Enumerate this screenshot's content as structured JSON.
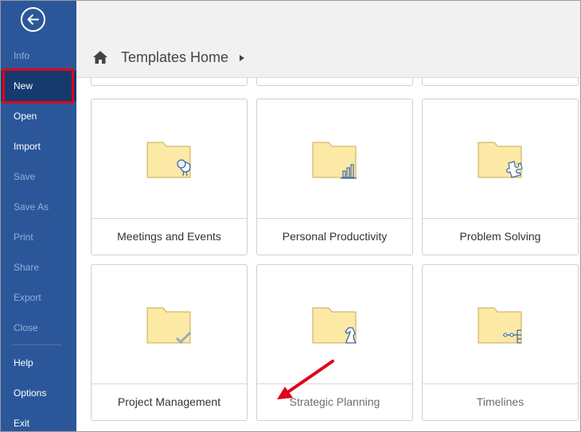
{
  "sidebar": {
    "items": [
      {
        "label": "Info",
        "state": "disabled"
      },
      {
        "label": "New",
        "state": "selected"
      },
      {
        "label": "Open",
        "state": "normal"
      },
      {
        "label": "Import",
        "state": "normal"
      },
      {
        "label": "Save",
        "state": "disabled"
      },
      {
        "label": "Save As",
        "state": "disabled"
      },
      {
        "label": "Print",
        "state": "disabled"
      },
      {
        "label": "Share",
        "state": "disabled"
      },
      {
        "label": "Export",
        "state": "disabled"
      },
      {
        "label": "Close",
        "state": "disabled"
      },
      {
        "label": "Help",
        "state": "normal"
      },
      {
        "label": "Options",
        "state": "normal"
      },
      {
        "label": "Exit",
        "state": "normal"
      }
    ]
  },
  "header": {
    "breadcrumb": "Templates Home"
  },
  "tiles": [
    {
      "label": "Meetings and Events",
      "icon": "meetings-icon"
    },
    {
      "label": "Personal Productivity",
      "icon": "productivity-chart-icon"
    },
    {
      "label": "Problem Solving",
      "icon": "puzzle-icon"
    },
    {
      "label": "Project Management",
      "icon": "checkmark-icon"
    },
    {
      "label": "Strategic Planning",
      "icon": "chess-knight-icon"
    },
    {
      "label": "Timelines",
      "icon": "timeline-icon"
    }
  ],
  "colors": {
    "sidebar": "#2b579a",
    "selected": "#163a6e",
    "highlight": "#e0001b",
    "folder": "#fde9a6"
  }
}
